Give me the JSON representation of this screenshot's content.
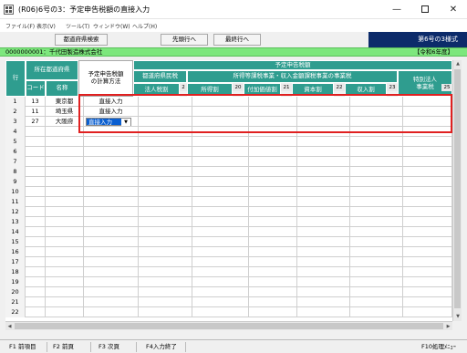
{
  "window": {
    "title": "(R06)6号の3：予定申告税額の直接入力"
  },
  "menu": [
    {
      "label": "ファイル(F)"
    },
    {
      "label": "表示(V)"
    },
    {
      "label": "ツール(T)"
    },
    {
      "label": "ウィンドウ(W)"
    },
    {
      "label": "ヘルプ(H)"
    }
  ],
  "toolbar": {
    "search_label": "都道府県検索",
    "first_row_label": "先頭行へ",
    "last_row_label": "最終行へ",
    "form_label": "第6号の3様式"
  },
  "infobar": {
    "company": "0000000001：千代田製造株式会社",
    "era": "【令和6年度】"
  },
  "header": {
    "row_label": "行",
    "location_label": "所在都道府県",
    "code_label": "コード",
    "name_label": "名称",
    "method_label_1": "予定申告税額",
    "method_label_2": "の計算方法",
    "tax_group_label": "予定申告税額",
    "pref_resident_label": "都道府県民税",
    "income_group_label": "所得等課税事業・収入金額課税事業の事業税",
    "corp_tax_label": "法人税割",
    "income_label": "所得割",
    "value_added_label": "付加価値割",
    "capital_label": "資本割",
    "revenue_label": "収入割",
    "special_label_1": "特別法人",
    "special_label_2": "事業税",
    "num_2": "2",
    "num_20": "20",
    "num_21": "21",
    "num_22": "22",
    "num_23": "23",
    "num_25": "25"
  },
  "rows": [
    {
      "no": "1",
      "code": "13",
      "name": "東京都",
      "method": "直接入力"
    },
    {
      "no": "2",
      "code": "11",
      "name": "埼玉県",
      "method": "直接入力"
    },
    {
      "no": "3",
      "code": "27",
      "name": "大阪府",
      "method": "直接入力"
    },
    {
      "no": "4",
      "code": "",
      "name": "",
      "method": ""
    },
    {
      "no": "5",
      "code": "",
      "name": "",
      "method": ""
    },
    {
      "no": "6",
      "code": "",
      "name": "",
      "method": ""
    },
    {
      "no": "7",
      "code": "",
      "name": "",
      "method": ""
    },
    {
      "no": "8",
      "code": "",
      "name": "",
      "method": ""
    },
    {
      "no": "9",
      "code": "",
      "name": "",
      "method": ""
    },
    {
      "no": "10",
      "code": "",
      "name": "",
      "method": ""
    },
    {
      "no": "11",
      "code": "",
      "name": "",
      "method": ""
    },
    {
      "no": "12",
      "code": "",
      "name": "",
      "method": ""
    },
    {
      "no": "13",
      "code": "",
      "name": "",
      "method": ""
    },
    {
      "no": "14",
      "code": "",
      "name": "",
      "method": ""
    },
    {
      "no": "15",
      "code": "",
      "name": "",
      "method": ""
    },
    {
      "no": "16",
      "code": "",
      "name": "",
      "method": ""
    },
    {
      "no": "17",
      "code": "",
      "name": "",
      "method": ""
    },
    {
      "no": "18",
      "code": "",
      "name": "",
      "method": ""
    },
    {
      "no": "19",
      "code": "",
      "name": "",
      "method": ""
    },
    {
      "no": "20",
      "code": "",
      "name": "",
      "method": ""
    },
    {
      "no": "21",
      "code": "",
      "name": "",
      "method": ""
    },
    {
      "no": "22",
      "code": "",
      "name": "",
      "method": ""
    }
  ],
  "function_keys": [
    {
      "label": "F1 前項目"
    },
    {
      "label": "F2 前頁"
    },
    {
      "label": "F3 次頁"
    },
    {
      "label": "F4入力終了"
    },
    {
      "label": "F10処理ﾒﾆｭｰ"
    }
  ]
}
